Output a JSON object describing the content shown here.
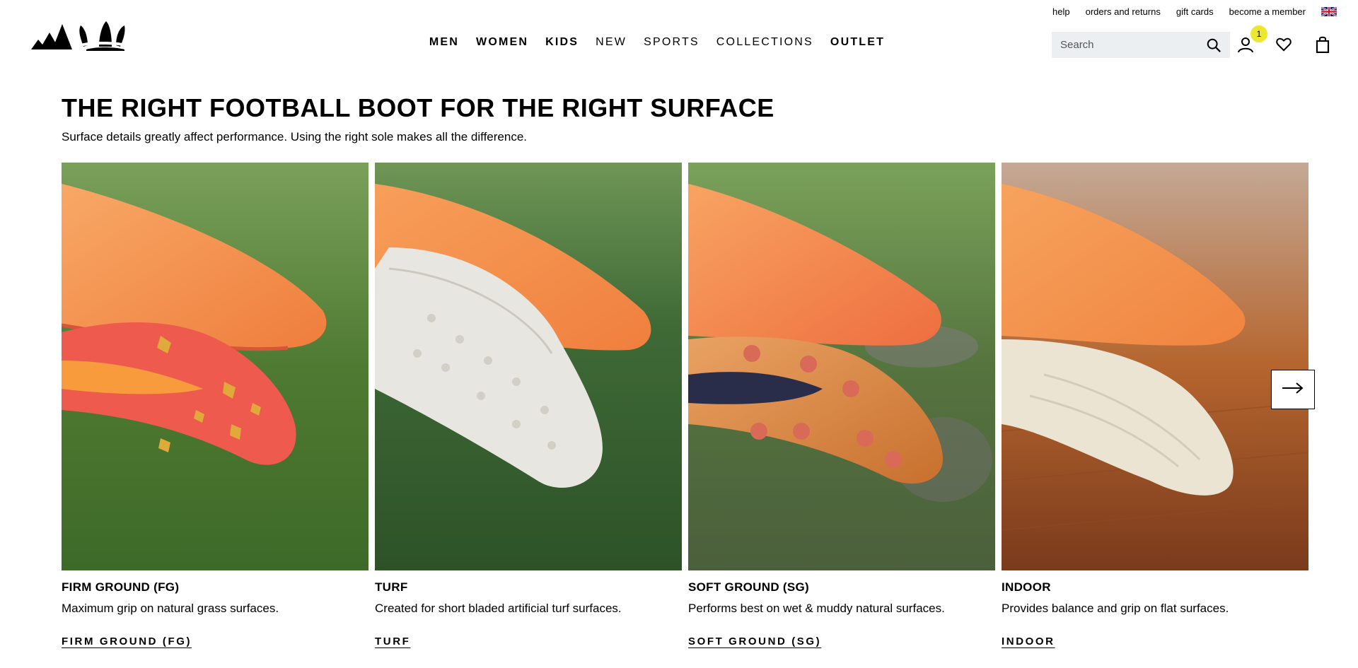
{
  "topbar": {
    "links": [
      "help",
      "orders and returns",
      "gift cards",
      "become a member"
    ]
  },
  "nav": {
    "items": [
      {
        "label": "MEN",
        "bold": true
      },
      {
        "label": "WOMEN",
        "bold": true
      },
      {
        "label": "KIDS",
        "bold": true
      },
      {
        "label": "NEW",
        "bold": false
      },
      {
        "label": "SPORTS",
        "bold": false
      },
      {
        "label": "COLLECTIONS",
        "bold": false
      },
      {
        "label": "OUTLET",
        "bold": true
      }
    ]
  },
  "search": {
    "placeholder": "Search"
  },
  "account": {
    "badge": "1"
  },
  "page": {
    "title": "THE RIGHT FOOTBALL BOOT FOR THE RIGHT SURFACE",
    "subtitle": "Surface details greatly affect performance. Using the right sole makes all the difference."
  },
  "cards": [
    {
      "name": "FIRM GROUND (FG)",
      "desc": "Maximum grip on natural grass surfaces.",
      "link": "FIRM GROUND (FG)"
    },
    {
      "name": "TURF",
      "desc": "Created for short bladed artificial turf surfaces.",
      "link": "TURF"
    },
    {
      "name": "SOFT GROUND (SG)",
      "desc": "Performs best on wet & muddy natural surfaces.",
      "link": "SOFT GROUND (SG)"
    },
    {
      "name": "INDOOR",
      "desc": "Provides balance and grip on flat surfaces.",
      "link": "INDOOR"
    }
  ],
  "colors": {
    "accent_badge": "#ede734",
    "boot_orange": "#f5934a",
    "grass": "#4f7a32",
    "wood": "#b5652e"
  }
}
